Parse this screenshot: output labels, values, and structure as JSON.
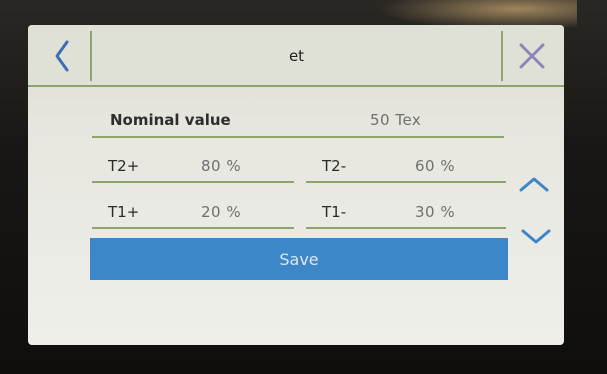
{
  "header": {
    "title": "et"
  },
  "form": {
    "nominal": {
      "label": "Nominal value",
      "value": "50 Tex"
    },
    "t2_plus": {
      "label": "T2+",
      "value": "80 %"
    },
    "t2_minus": {
      "label": "T2-",
      "value": "60 %"
    },
    "t1_plus": {
      "label": "T1+",
      "value": "20 %"
    },
    "t1_minus": {
      "label": "T1-",
      "value": "30 %"
    }
  },
  "actions": {
    "save_label": "Save"
  },
  "colors": {
    "accent_blue": "#3d87c9",
    "divider_green": "#8da56d",
    "close_purple": "#8b86b6"
  },
  "icons": {
    "back": "chevron-left-icon",
    "close": "close-icon",
    "up": "chevron-up-icon",
    "down": "chevron-down-icon"
  }
}
